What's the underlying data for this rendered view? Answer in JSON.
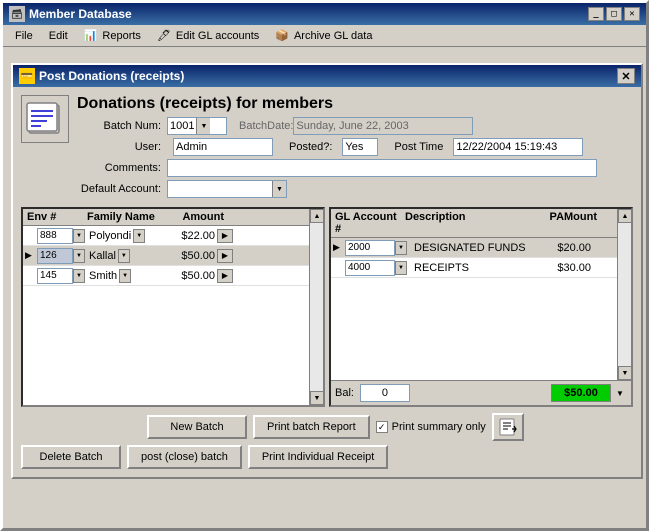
{
  "app": {
    "title": "Member Database",
    "close": "✕",
    "minimize": "_",
    "maximize": "□"
  },
  "menu": {
    "items": [
      {
        "label": "File",
        "name": "file"
      },
      {
        "label": "Edit",
        "name": "edit"
      },
      {
        "label": "Reports",
        "name": "reports"
      },
      {
        "label": "Edit GL accounts",
        "name": "edit-gl"
      },
      {
        "label": "Archive GL data",
        "name": "archive-gl"
      }
    ]
  },
  "dialog": {
    "title": "Post Donations (receipts)",
    "header_title": "Donations (receipts) for members",
    "batch_num_label": "Batch Num:",
    "batch_num_value": "1001",
    "batch_date_label": "BatchDate:",
    "batch_date_value": "Sunday, June 22, 2003",
    "user_label": "User:",
    "user_value": "Admin",
    "posted_label": "Posted?:",
    "posted_value": "Yes",
    "post_time_label": "Post Time",
    "post_time_value": "12/22/2004 15:19:43",
    "comments_label": "Comments:",
    "comments_value": "",
    "default_account_label": "Default Account:"
  },
  "left_table": {
    "columns": [
      "Env #",
      "Family Name",
      "Amount",
      ""
    ],
    "rows": [
      {
        "env": "888",
        "family": "Polyondi",
        "amount": "$22.00",
        "selected": false
      },
      {
        "env": "126",
        "family": "Kallal",
        "amount": "$50.00",
        "selected": true
      },
      {
        "env": "145",
        "family": "Smith",
        "amount": "$50.00",
        "selected": false
      }
    ]
  },
  "right_table": {
    "columns": [
      "GL Account #",
      "Description",
      "PAMount"
    ],
    "rows": [
      {
        "gl": "2000",
        "description": "DESIGNATED FUNDS",
        "amount": "$20.00",
        "selected": true
      },
      {
        "gl": "4000",
        "description": "RECEIPTS",
        "amount": "$30.00",
        "selected": false
      }
    ]
  },
  "balance": {
    "label": "Bal:",
    "value": "0",
    "amount": "$50.00"
  },
  "buttons": {
    "row1": [
      {
        "label": "New Batch",
        "name": "new-batch-btn"
      },
      {
        "label": "Print batch Report",
        "name": "print-batch-report-btn"
      },
      {
        "label": "Print summary only",
        "name": "print-summary-checkbox",
        "checked": true
      }
    ],
    "row2": [
      {
        "label": "Delete Batch",
        "name": "delete-batch-btn"
      },
      {
        "label": "post (close) batch",
        "name": "post-close-batch-btn"
      },
      {
        "label": "Print Individual Receipt",
        "name": "print-individual-receipt-btn"
      }
    ]
  },
  "icons": {
    "app": "🗃",
    "dialog": "💳",
    "header": "📋",
    "export": "↵"
  }
}
